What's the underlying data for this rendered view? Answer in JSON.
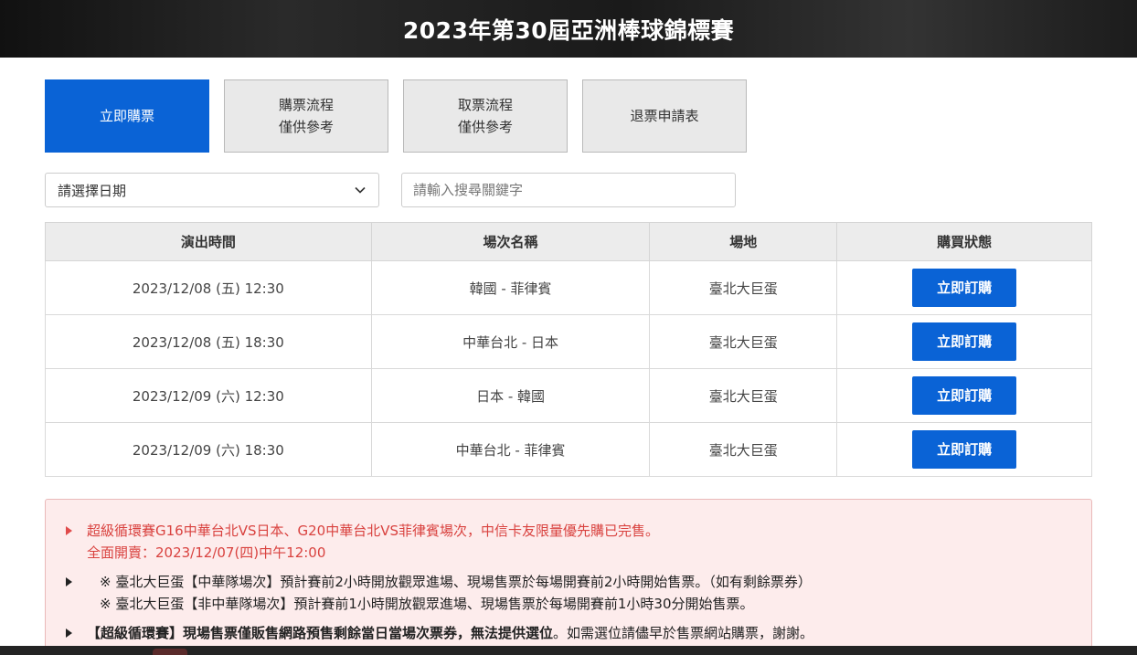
{
  "banner": {
    "title": "2023年第30屆亞洲棒球錦標賽"
  },
  "buttons": [
    {
      "line1": "立即購票",
      "line2": ""
    },
    {
      "line1": "購票流程",
      "line2": "僅供參考"
    },
    {
      "line1": "取票流程",
      "line2": "僅供參考"
    },
    {
      "line1": "退票申請表",
      "line2": ""
    }
  ],
  "filters": {
    "date_select": "請選擇日期",
    "search_placeholder": "請輸入搜尋關鍵字"
  },
  "table": {
    "headers": [
      "演出時間",
      "場次名稱",
      "場地",
      "購買狀態"
    ],
    "rows": [
      {
        "time": "2023/12/08 (五) 12:30",
        "name": "韓國 - 菲律賓",
        "venue": "臺北大巨蛋",
        "action": "立即訂購"
      },
      {
        "time": "2023/12/08 (五) 18:30",
        "name": "中華台北 - 日本",
        "venue": "臺北大巨蛋",
        "action": "立即訂購"
      },
      {
        "time": "2023/12/09 (六) 12:30",
        "name": "日本 - 韓國",
        "venue": "臺北大巨蛋",
        "action": "立即訂購"
      },
      {
        "time": "2023/12/09 (六) 18:30",
        "name": "中華台北 - 菲律賓",
        "venue": "臺北大巨蛋",
        "action": "立即訂購"
      }
    ]
  },
  "notice": {
    "item1_line1": "超級循環賽G16中華台北VS日本、G20中華台北VS菲律賓場次，中信卡友限量優先購已完售。",
    "item1_line2": "全面開賣：2023/12/07(四)中午12:00",
    "item2_line1": "※ 臺北大巨蛋【中華隊場次】預計賽前2小時開放觀眾進場、現場售票於每場開賽前2小時開始售票。（如有剩餘票券）",
    "item2_line2": "※ 臺北大巨蛋【非中華隊場次】預計賽前1小時開放觀眾進場、現場售票於每場開賽前1小時30分開始售票。",
    "item3_bold": "【超級循環賽】現場售票僅販售網路預售剩餘當日當場次票券，無法提供選位",
    "item3_rest": "。如需選位請儘早於售票網站購票，謝謝。"
  },
  "colors": {
    "primary": "#0a63d6",
    "notice_bg": "#fdecec",
    "notice_red": "#d9423f"
  }
}
